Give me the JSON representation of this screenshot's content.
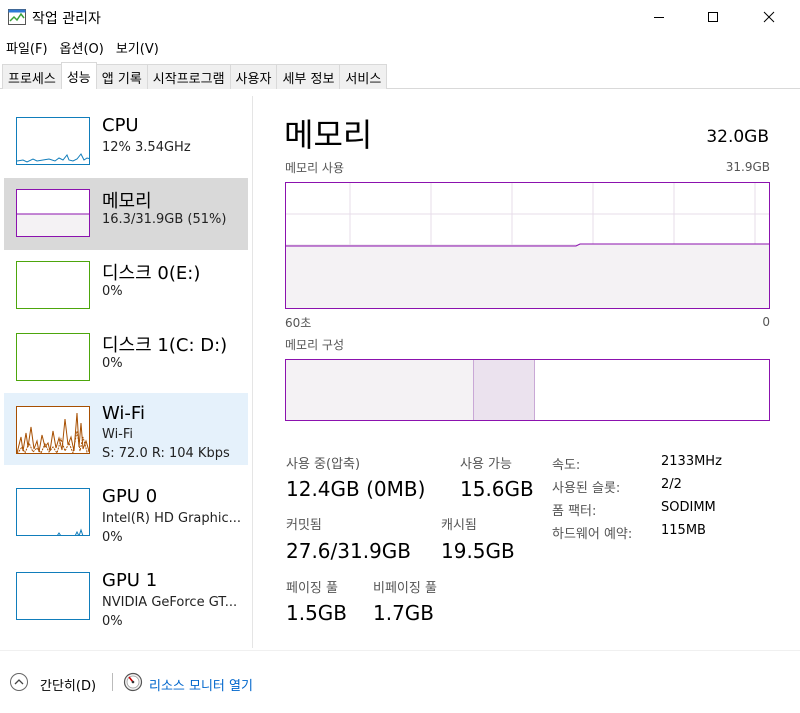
{
  "window": {
    "title": "작업 관리자"
  },
  "menu": [
    "파일(F)",
    "옵션(O)",
    "보기(V)"
  ],
  "tabs": [
    "프로세스",
    "성능",
    "앱 기록",
    "시작프로그램",
    "사용자",
    "세부 정보",
    "서비스"
  ],
  "active_tab_index": 1,
  "sidebar": [
    {
      "title": "CPU",
      "line1": "12% 3.54GHz",
      "line2": "",
      "color": "#117dbb"
    },
    {
      "title": "메모리",
      "line1": "16.3/31.9GB (51%)",
      "line2": "",
      "color": "#8b12ae"
    },
    {
      "title": "디스크 0(E:)",
      "line1": "0%",
      "line2": "",
      "color": "#4da60c"
    },
    {
      "title": "디스크 1(C: D:)",
      "line1": "0%",
      "line2": "",
      "color": "#4da60c"
    },
    {
      "title": "Wi-Fi",
      "line1": "Wi-Fi",
      "line2": "S: 72.0 R: 104 Kbps",
      "color": "#a74f01"
    },
    {
      "title": "GPU 0",
      "line1": "Intel(R) HD Graphic...",
      "line2": "0%",
      "color": "#117dbb"
    },
    {
      "title": "GPU 1",
      "line1": "NVIDIA GeForce GT...",
      "line2": "0%",
      "color": "#117dbb"
    }
  ],
  "main": {
    "title": "메모리",
    "total": "32.0GB",
    "usage_label": "메모리 사용",
    "usage_max": "31.9GB",
    "time_left": "60초",
    "time_right": "0",
    "composition_label": "메모리 구성",
    "usage_fraction": 0.51,
    "stats": {
      "in_use_label": "사용 중(압축)",
      "in_use_value": "12.4GB (0MB)",
      "available_label": "사용 가능",
      "available_value": "15.6GB",
      "committed_label": "커밋됨",
      "committed_value": "27.6/31.9GB",
      "cached_label": "캐시됨",
      "cached_value": "19.5GB",
      "paged_label": "페이징 풀",
      "paged_value": "1.5GB",
      "nonpaged_label": "비페이징 풀",
      "nonpaged_value": "1.7GB"
    },
    "details": [
      {
        "key": "속도:",
        "value": "2133MHz"
      },
      {
        "key": "사용된 슬롯:",
        "value": "2/2"
      },
      {
        "key": "폼 팩터:",
        "value": "SODIMM"
      },
      {
        "key": "하드웨어 예약:",
        "value": "115MB"
      }
    ]
  },
  "bottom": {
    "collapse_label": "간단히(D)",
    "resource_monitor_label": "리소스 모니터 열기"
  },
  "colors": {
    "memory": "#8b12ae",
    "link": "#0066cc"
  }
}
